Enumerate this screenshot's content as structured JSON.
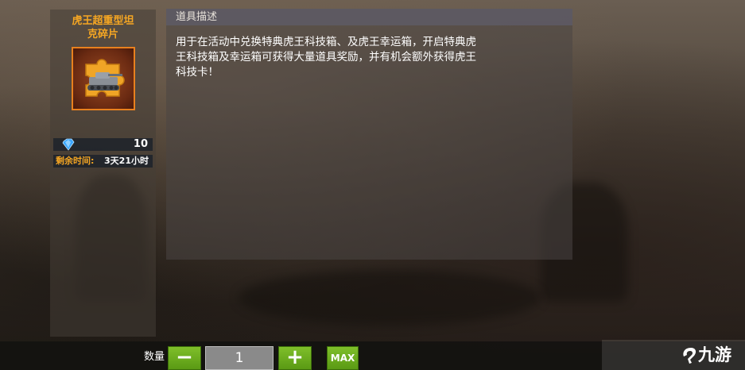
{
  "item": {
    "name_line1": "虎王超重型坦",
    "name_line2": "克碎片",
    "icon": "tank-puzzle-icon",
    "gem_icon": "diamond-icon",
    "count": "10",
    "time_label": "剩余时间:",
    "time_value": "3天21小时"
  },
  "description": {
    "title": "道具描述",
    "line1": "用于在活动中兑换特典虎王科技箱、及虎王幸运箱，开启特典虎",
    "line2": "王科技箱及幸运箱可获得大量道具奖励，并有机会额外获得虎王",
    "line3": "科技卡！"
  },
  "quantity": {
    "label": "数量",
    "minus": "−",
    "value": "1",
    "plus": "+",
    "max": "MAX"
  },
  "watermark": {
    "text": "九游",
    "logo": "jiuyou-logo"
  },
  "colors": {
    "accent_orange": "#f5a623",
    "button_green": "#6aaa1e"
  }
}
